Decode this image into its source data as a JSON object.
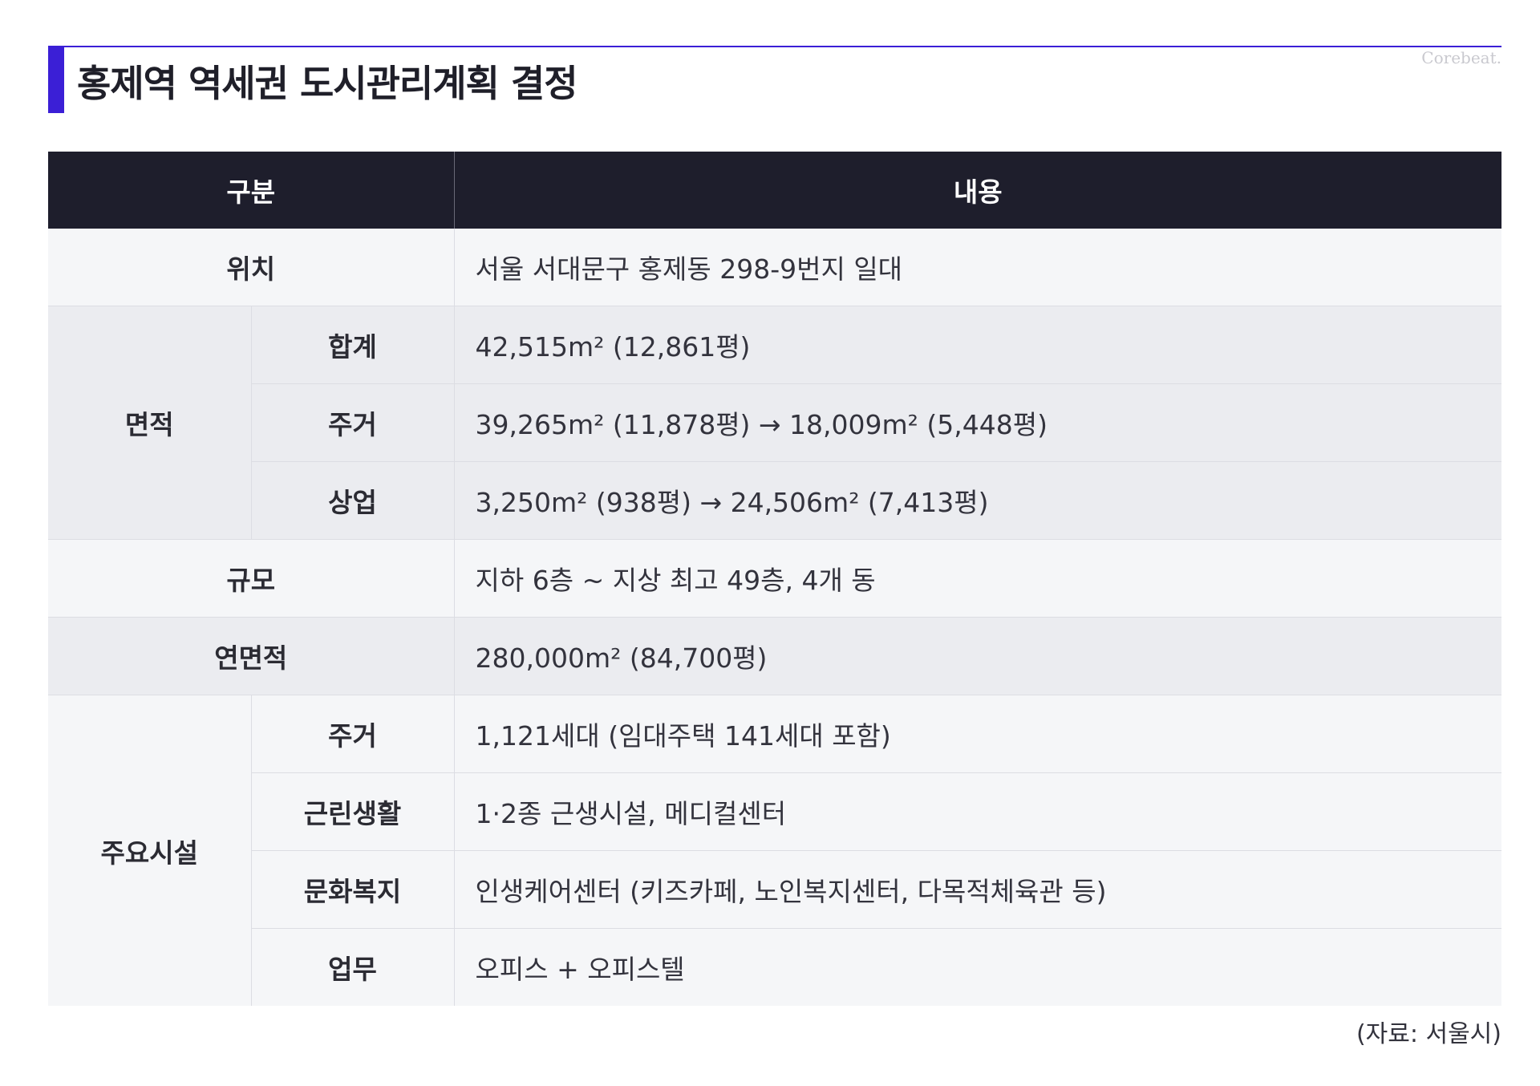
{
  "title": "홍제역 역세권 도시관리계획 결정",
  "watermark": "Corebeat.",
  "table": {
    "headers": {
      "category": "구분",
      "content": "내용"
    },
    "location": {
      "label": "위치",
      "value": "서울 서대문구 홍제동 298-9번지 일대"
    },
    "area": {
      "label": "면적",
      "rows": [
        {
          "label": "합계",
          "value": "42,515m² (12,861평)"
        },
        {
          "label": "주거",
          "value": "39,265m² (11,878평) → 18,009m² (5,448평)"
        },
        {
          "label": "상업",
          "value": "3,250m² (938평) → 24,506m² (7,413평)"
        }
      ]
    },
    "scale": {
      "label": "규모",
      "value": "지하 6층 ~ 지상 최고 49층, 4개 동"
    },
    "floor_area": {
      "label": "연면적",
      "value": "280,000m² (84,700평)"
    },
    "facilities": {
      "label": "주요시설",
      "rows": [
        {
          "label": "주거",
          "value": "1,121세대 (임대주택 141세대 포함)"
        },
        {
          "label": "근린생활",
          "value": "1·2종 근생시설, 메디컬센터"
        },
        {
          "label": "문화복지",
          "value": "인생케어센터 (키즈카페, 노인복지센터, 다목적체육관 등)"
        },
        {
          "label": "업무",
          "value": "오피스 + 오피스텔"
        }
      ]
    }
  },
  "source": "(자료: 서울시)",
  "colors": {
    "accent": "#3b1fd6",
    "header_bg": "#1e1e2c",
    "row_light": "#f5f6f8",
    "row_dark": "#ebecf0"
  }
}
